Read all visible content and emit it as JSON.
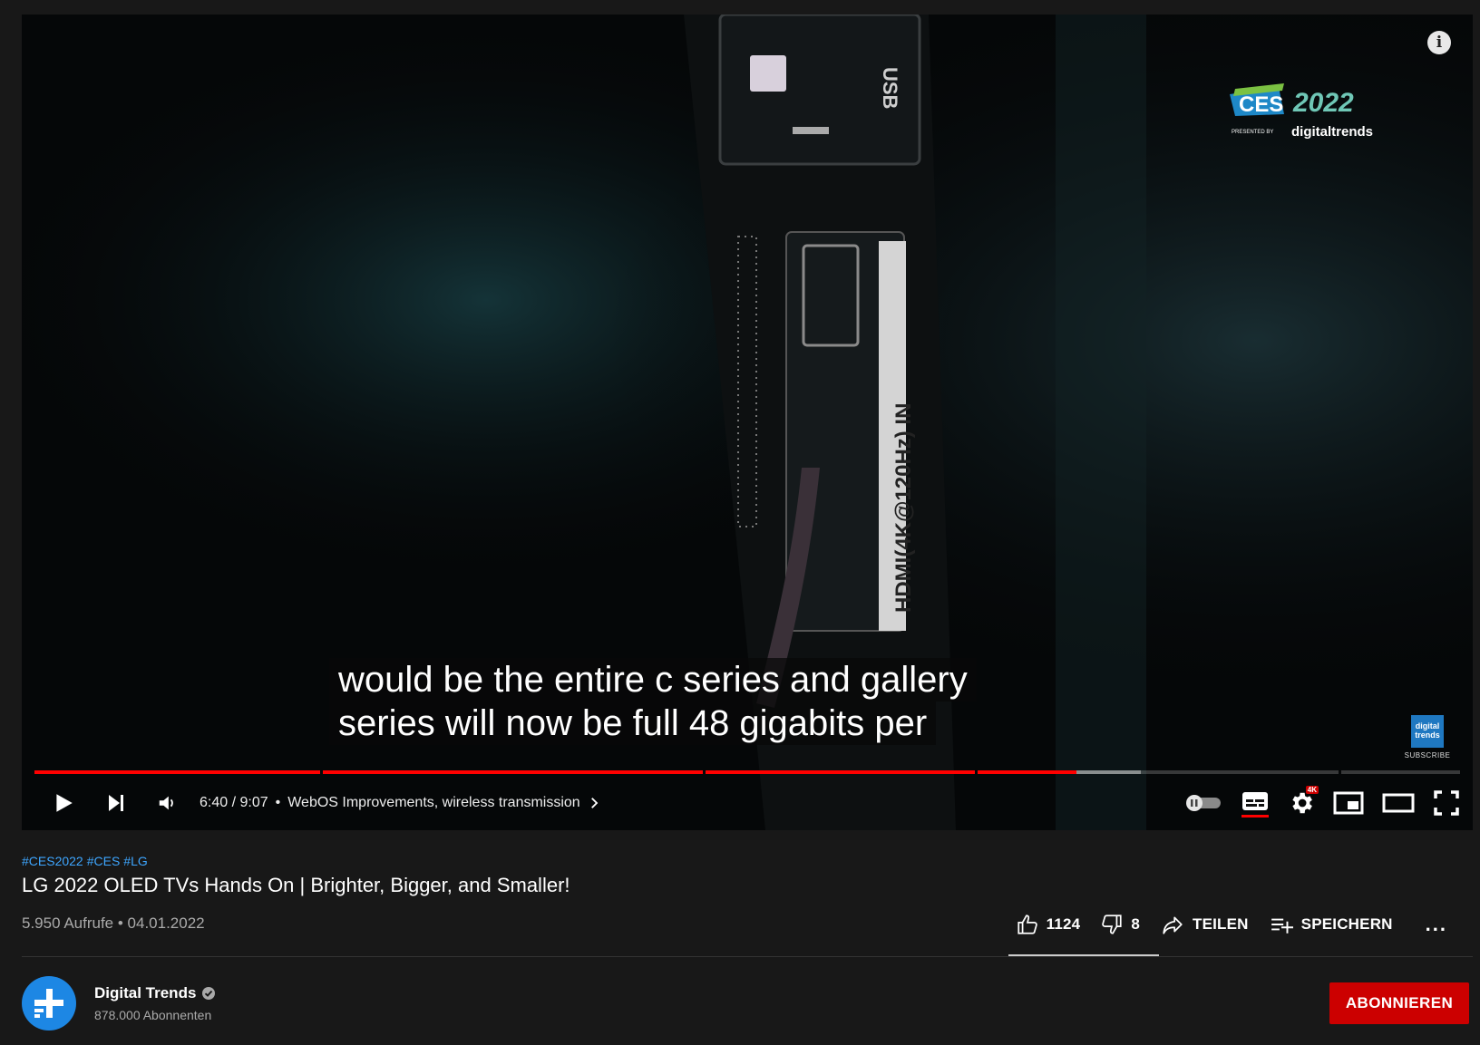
{
  "player": {
    "overlay_logo": {
      "event": "CES",
      "year": "2022",
      "presented_by": "PRESENTED BY",
      "brand": "digitaltrends"
    },
    "info_icon": "i",
    "badge": {
      "text_top": "digital",
      "text_bottom": "trends",
      "label": "SUBSCRIBE"
    },
    "captions": [
      "would be the entire c series and gallery",
      "series will now be full 48 gigabits per"
    ],
    "progress": {
      "played_fraction": 0.7315,
      "buffered_fraction": 0.7768,
      "chapters": [
        {
          "start": 0.0,
          "end": 0.2025
        },
        {
          "start": 0.2025,
          "end": 0.4705
        },
        {
          "start": 0.4705,
          "end": 0.6615
        },
        {
          "start": 0.6615,
          "end": 0.9165
        },
        {
          "start": 0.9165,
          "end": 1.0
        }
      ]
    },
    "controls": {
      "time": "6:40 / 9:07",
      "chapter_separator": "•",
      "chapter_title": "WebOS Improvements, wireless transmission",
      "quality_badge": "4K",
      "icons": [
        "play-icon",
        "next-icon",
        "volume-icon",
        "autoplay-toggle",
        "subtitles-icon",
        "settings-icon",
        "miniplayer-icon",
        "theater-icon",
        "fullscreen-icon"
      ]
    }
  },
  "video": {
    "hashtags": [
      "#CES2022",
      "#CES",
      "#LG"
    ],
    "title": "LG 2022 OLED TVs Hands On | Brighter, Bigger, and Smaller!",
    "meta": "5.950 Aufrufe • 04.01.2022",
    "likes": "1124",
    "dislikes": "8",
    "share_label": "TEILEN",
    "save_label": "SPEICHERN",
    "more_label": "..."
  },
  "channel": {
    "name": "Digital Trends",
    "subscribers": "878.000 Abonnenten",
    "subscribe_label": "ABONNIEREN"
  },
  "colors": {
    "accent": "#ff0000",
    "link": "#3ea6ff",
    "subscribe": "#cc0000",
    "channel_avatar": "#1d87e4"
  }
}
